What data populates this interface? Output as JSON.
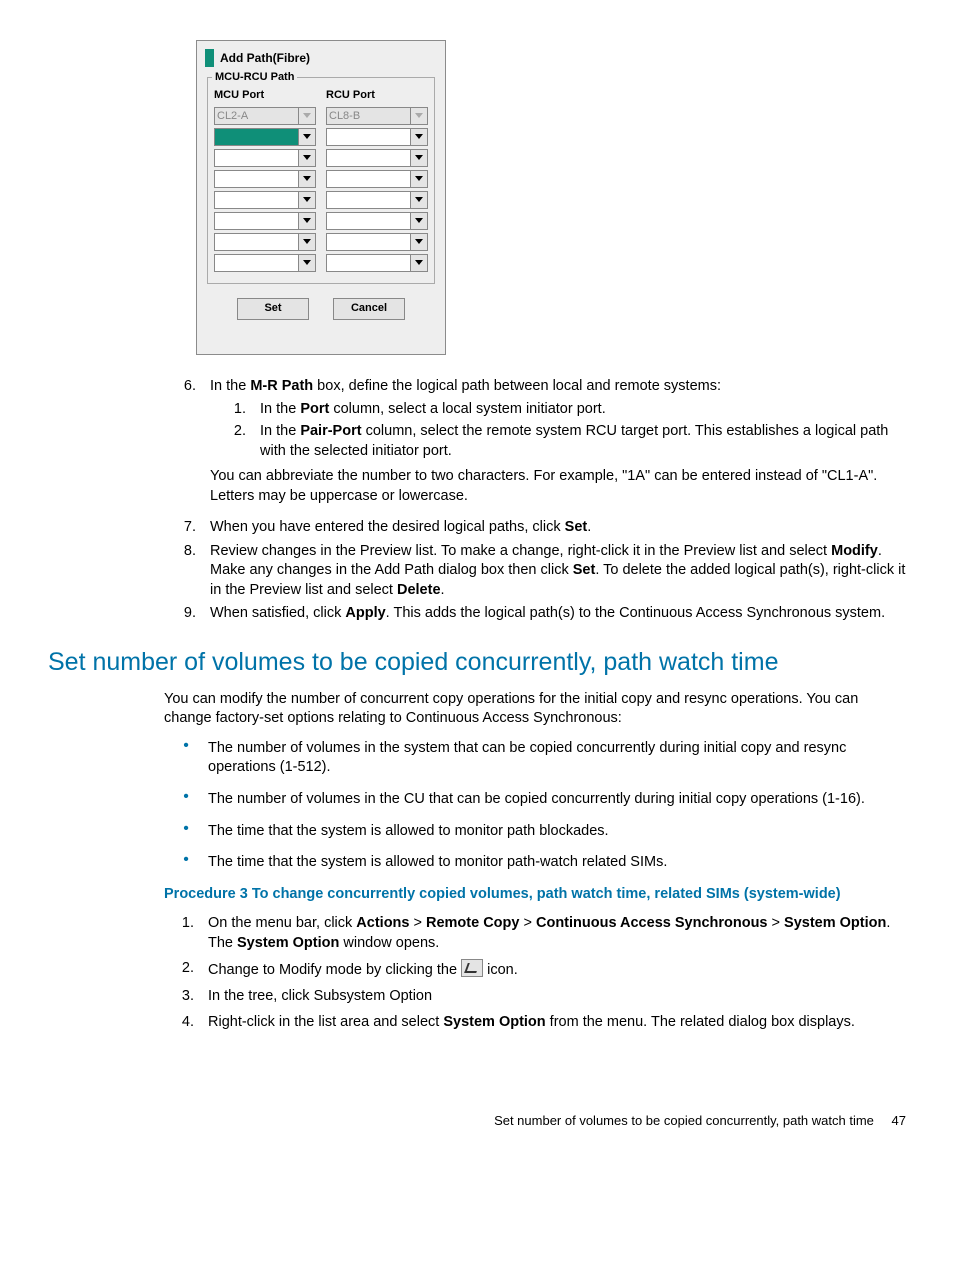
{
  "dialog": {
    "title": "Add Path(Fibre)",
    "fieldset_label": "MCU-RCU Path",
    "mcu_label": "MCU Port",
    "rcu_label": "RCU Port",
    "mcu_first": "CL2-A",
    "rcu_first": "CL8-B",
    "set_btn": "Set",
    "cancel_btn": "Cancel"
  },
  "steps": {
    "s6": {
      "num": "6.",
      "lead": "In the ",
      "b1": "M-R Path",
      "tail": " box, define the logical path between local and remote systems:",
      "sub1_num": "1.",
      "sub1_a": "In the ",
      "sub1_b": "Port",
      "sub1_c": " column, select a local system initiator port.",
      "sub2_num": "2.",
      "sub2_a": "In the ",
      "sub2_b": "Pair-Port",
      "sub2_c": " column, select the remote system RCU target port. This establishes a logical path with the selected initiator port.",
      "note": "You can abbreviate the number to two characters. For example, \"1A\" can be entered instead of \"CL1-A\". Letters may be uppercase or lowercase."
    },
    "s7": {
      "num": "7.",
      "a": "When you have entered the desired logical paths, click ",
      "b": "Set",
      "c": "."
    },
    "s8": {
      "num": "8.",
      "a": "Review changes in the Preview list. To make a change, right-click it in the Preview list and select ",
      "b1": "Modify",
      "mid": ". Make any changes in the Add Path dialog box then click ",
      "b2": "Set",
      "mid2": ". To delete the added logical path(s), right-click it in the Preview list and select ",
      "b3": "Delete",
      "end": "."
    },
    "s9": {
      "num": "9.",
      "a": "When satisfied, click ",
      "b": "Apply",
      "c": ". This adds the logical path(s) to the Continuous Access Synchronous system."
    }
  },
  "section_heading": "Set number of volumes to be copied concurrently, path watch time",
  "section_intro": "You can modify the number of concurrent copy operations for the initial copy and resync operations. You can change factory-set options relating to Continuous Access Synchronous:",
  "bullets": {
    "b1": "The number of volumes in the system that can be copied concurrently during initial copy and resync operations (1-512).",
    "b2": "The number of volumes in the CU that can be copied concurrently during initial copy operations (1-16).",
    "b3": "The time that the system is allowed to monitor path blockades.",
    "b4": "The time that the system is allowed to monitor path-watch related SIMs."
  },
  "proc_title": "Procedure 3 To change concurrently copied volumes, path watch time, related SIMs (system-wide)",
  "proc": {
    "p1_num": "1.",
    "p1_a": "On the menu bar, click ",
    "p1_b1": "Actions",
    "p1_s": " > ",
    "p1_b2": "Remote Copy",
    "p1_b3": "Continuous Access Synchronous",
    "p1_b4": "System Option",
    "p1_mid": ". The ",
    "p1_b5": "System Option",
    "p1_end": " window opens.",
    "p2_num": "2.",
    "p2_a": "Change to Modify mode by clicking the ",
    "p2_b": " icon.",
    "p3_num": "3.",
    "p3": "In the tree, click Subsystem Option",
    "p4_num": "4.",
    "p4_a": "Right-click in the list area and select ",
    "p4_b": "System Option",
    "p4_c": " from the menu. The related dialog box displays."
  },
  "footer_text": "Set number of volumes to be copied concurrently, path watch time",
  "footer_page": "47"
}
